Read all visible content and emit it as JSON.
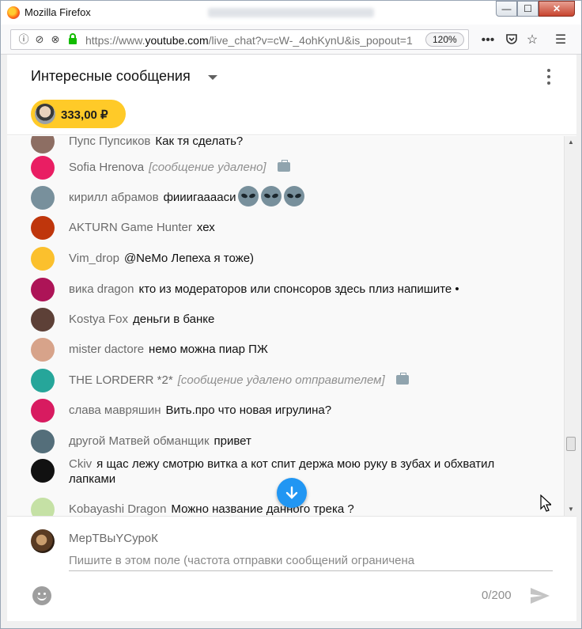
{
  "window": {
    "title": "Mozilla Firefox",
    "controls": {
      "minimize": "—",
      "maximize": "☐",
      "close": "✕"
    }
  },
  "navbar": {
    "url_prefix": "https://www.",
    "url_domain": "youtube.com",
    "url_rest": "/live_chat?v=cW-_4ohKynU&is_popout=1",
    "zoom": "120%",
    "icons": [
      "info-icon",
      "permissions-icon",
      "autoplay-blocked-icon",
      "lock-icon",
      "more-icon",
      "pocket-icon",
      "bookmark-star-icon",
      "menu-icon"
    ]
  },
  "chat": {
    "title": "Интересные сообщения",
    "superchat_amount": "333,00 ₽"
  },
  "messages": [
    {
      "author": "Пупс Пупсиков",
      "text": "Как тя сделать?",
      "avatar_color": "#8d6e63"
    },
    {
      "author": "Sofia Hrenova",
      "text": "[сообщение удалено]",
      "deleted": true,
      "avatar_color": "#e91e63"
    },
    {
      "author": "кирилл абрамов",
      "text": "фииигааааси",
      "aliens": 3,
      "avatar_color": "#78909c"
    },
    {
      "author": "AKTURN Game Hunter",
      "text": "хех",
      "avatar_color": "#bf360c"
    },
    {
      "author": "Vim_drop",
      "text": "@NeMo Лепеха я тоже)",
      "avatar_color": "#fbc02d"
    },
    {
      "author": "вика dragon",
      "text": "кто из модераторов или спонсоров здесь плиз напишите •",
      "avatar_color": "#ad1457"
    },
    {
      "author": "Kostya Fox",
      "text": "деньги в банке",
      "avatar_color": "#5d4037"
    },
    {
      "author": "mister dactore",
      "text": "немо можна пиар ПЖ",
      "avatar_color": "#d7a38a"
    },
    {
      "author": "THE LORDERR *2*",
      "text": "[сообщение удалено отправителем]",
      "deleted": true,
      "avatar_color": "#26a69a"
    },
    {
      "author": "слава мавряшин",
      "text": "Вить.про что новая игрулина?",
      "avatar_color": "#d81b60"
    },
    {
      "author": "другой Матвей обманщик",
      "text": "привет",
      "avatar_color": "#546e7a"
    },
    {
      "author": "Ckiv",
      "text": "я щас лежу смотрю витка а кот спит держа мою руку в зубах и обхватил лапками",
      "avatar_color": "#111111"
    },
    {
      "author": "Kobayashi Dragon",
      "text": "Можно название данного трека ?",
      "avatar_color": "#c5e1a5"
    }
  ],
  "composer": {
    "user_name": "МерТВыYСуроК",
    "placeholder": "Пишите в этом поле (частота отправки сообщений ограничена",
    "counter": "0/200"
  },
  "colors": {
    "accent": "#2196f3",
    "superchat": "#ffca28"
  }
}
